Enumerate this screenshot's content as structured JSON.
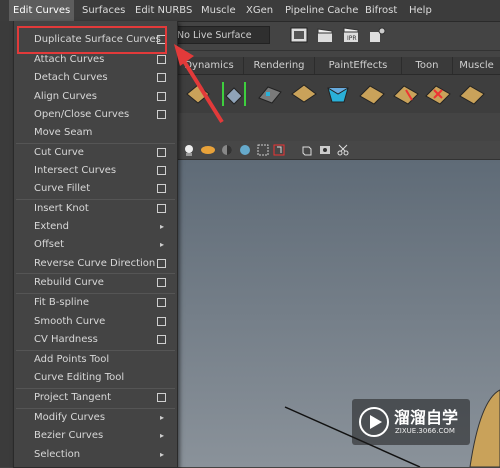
{
  "menubar": {
    "items": [
      "Edit Curves",
      "Surfaces",
      "Edit NURBS",
      "Muscle",
      "XGen",
      "Pipeline Cache",
      "Bifrost",
      "Help"
    ]
  },
  "statusline": {
    "live_surface_label": "No Live Surface"
  },
  "shelf": {
    "tabs": [
      "Dynamics",
      "Rendering",
      "PaintEffects",
      "Toon",
      "Muscle"
    ]
  },
  "menu": {
    "items": [
      {
        "label": "Duplicate Surface Curves",
        "option": true
      },
      {
        "label": "Attach Curves",
        "option": true
      },
      {
        "label": "Detach Curves",
        "option": true
      },
      {
        "label": "Align Curves",
        "option": true
      },
      {
        "label": "Open/Close Curves",
        "option": true
      },
      {
        "label": "Move Seam",
        "option": false
      },
      {
        "label": "Cut Curve",
        "option": true
      },
      {
        "label": "Intersect Curves",
        "option": true
      },
      {
        "label": "Curve Fillet",
        "option": true
      },
      {
        "label": "Insert Knot",
        "option": true
      },
      {
        "label": "Extend",
        "submenu": true
      },
      {
        "label": "Offset",
        "submenu": true
      },
      {
        "label": "Reverse Curve Direction",
        "option": true
      },
      {
        "label": "Rebuild Curve",
        "option": true
      },
      {
        "label": "Fit B-spline",
        "option": true
      },
      {
        "label": "Smooth Curve",
        "option": true
      },
      {
        "label": "CV Hardness",
        "option": true
      },
      {
        "label": "Add Points Tool",
        "option": false
      },
      {
        "label": "Curve Editing Tool",
        "option": false
      },
      {
        "label": "Project Tangent",
        "option": true
      },
      {
        "label": "Modify Curves",
        "submenu": true
      },
      {
        "label": "Bezier Curves",
        "submenu": true
      },
      {
        "label": "Selection",
        "submenu": true
      }
    ]
  },
  "watermark": {
    "title": "溜溜自学",
    "url": "ZIXUE.3066.COM"
  },
  "colors": {
    "annotation_red": "#e23a3a",
    "maya_bg": "#444444"
  }
}
